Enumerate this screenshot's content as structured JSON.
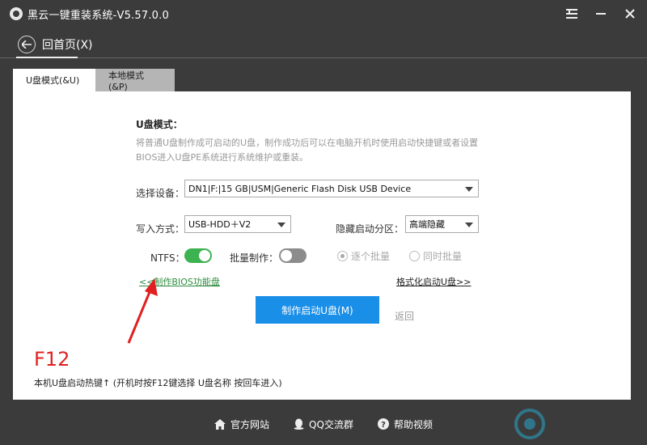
{
  "window": {
    "title": "黑云一键重装系统-V5.57.0.0"
  },
  "nav": {
    "back_label": "回首页(X)"
  },
  "tabs": [
    {
      "label": "U盘模式(&U)",
      "active": true
    },
    {
      "label": "本地模式(&P)",
      "active": false
    }
  ],
  "main": {
    "section_title": "U盘模式：",
    "description": "将普通U盘制作成可启动的U盘，制作成功后可以在电脑开机时使用启动快捷键或者设置BIOS进入U盘PE系统进行系统维护或重装。",
    "device_label": "选择设备：",
    "device_value": "DN1|F:|15 GB|USM|Generic Flash Disk USB Device",
    "write_label": "写入方式：",
    "write_value": "USB-HDD＋V2",
    "hidden_label": "隐藏启动分区：",
    "hidden_value": "高端隐藏",
    "ntfs_label": "NTFS：",
    "ntfs_on": true,
    "batch_label": "批量制作：",
    "batch_on": false,
    "radio_one": "逐个批量",
    "radio_all": "同时批量",
    "bios_link": "<<制作BIOS功能盘",
    "format_link": "格式化启动U盘>>",
    "make_button": "制作启动U盘(M)",
    "return_link": "返回",
    "hotkey_key": "F12",
    "hotkey_text": "本机U盘启动热键↑ (开机时按F12键选择 U盘名称 按回车进入)"
  },
  "footer": {
    "site": "官方网站",
    "qq": "QQ交流群",
    "video": "帮助视频"
  },
  "colors": {
    "titlebar": "#3b3b3b",
    "primary": "#1a8fe8",
    "toggle_on": "#3cb251",
    "link_green": "#2c8c3c",
    "hotkey_red": "#e02020",
    "arrow_red": "#e02020"
  }
}
